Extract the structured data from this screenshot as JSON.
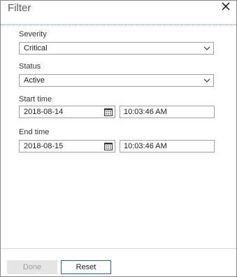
{
  "panel": {
    "title": "Filter"
  },
  "fields": {
    "severity": {
      "label": "Severity",
      "value": "Critical"
    },
    "status": {
      "label": "Status",
      "value": "Active"
    },
    "start_time": {
      "label": "Start time",
      "date": "2018-08-14",
      "time": "10:03:46 AM"
    },
    "end_time": {
      "label": "End time",
      "date": "2018-08-15",
      "time": "10:03:46 AM"
    }
  },
  "footer": {
    "done_label": "Done",
    "reset_label": "Reset"
  },
  "colors": {
    "header_rule": "#1ba1e2",
    "reset_border": "#1f5fbf",
    "done_disabled_bg": "#e5e5e5"
  },
  "icons": {
    "close": "close-icon",
    "dropdown": "chevron-down-icon",
    "calendar": "calendar-icon"
  }
}
